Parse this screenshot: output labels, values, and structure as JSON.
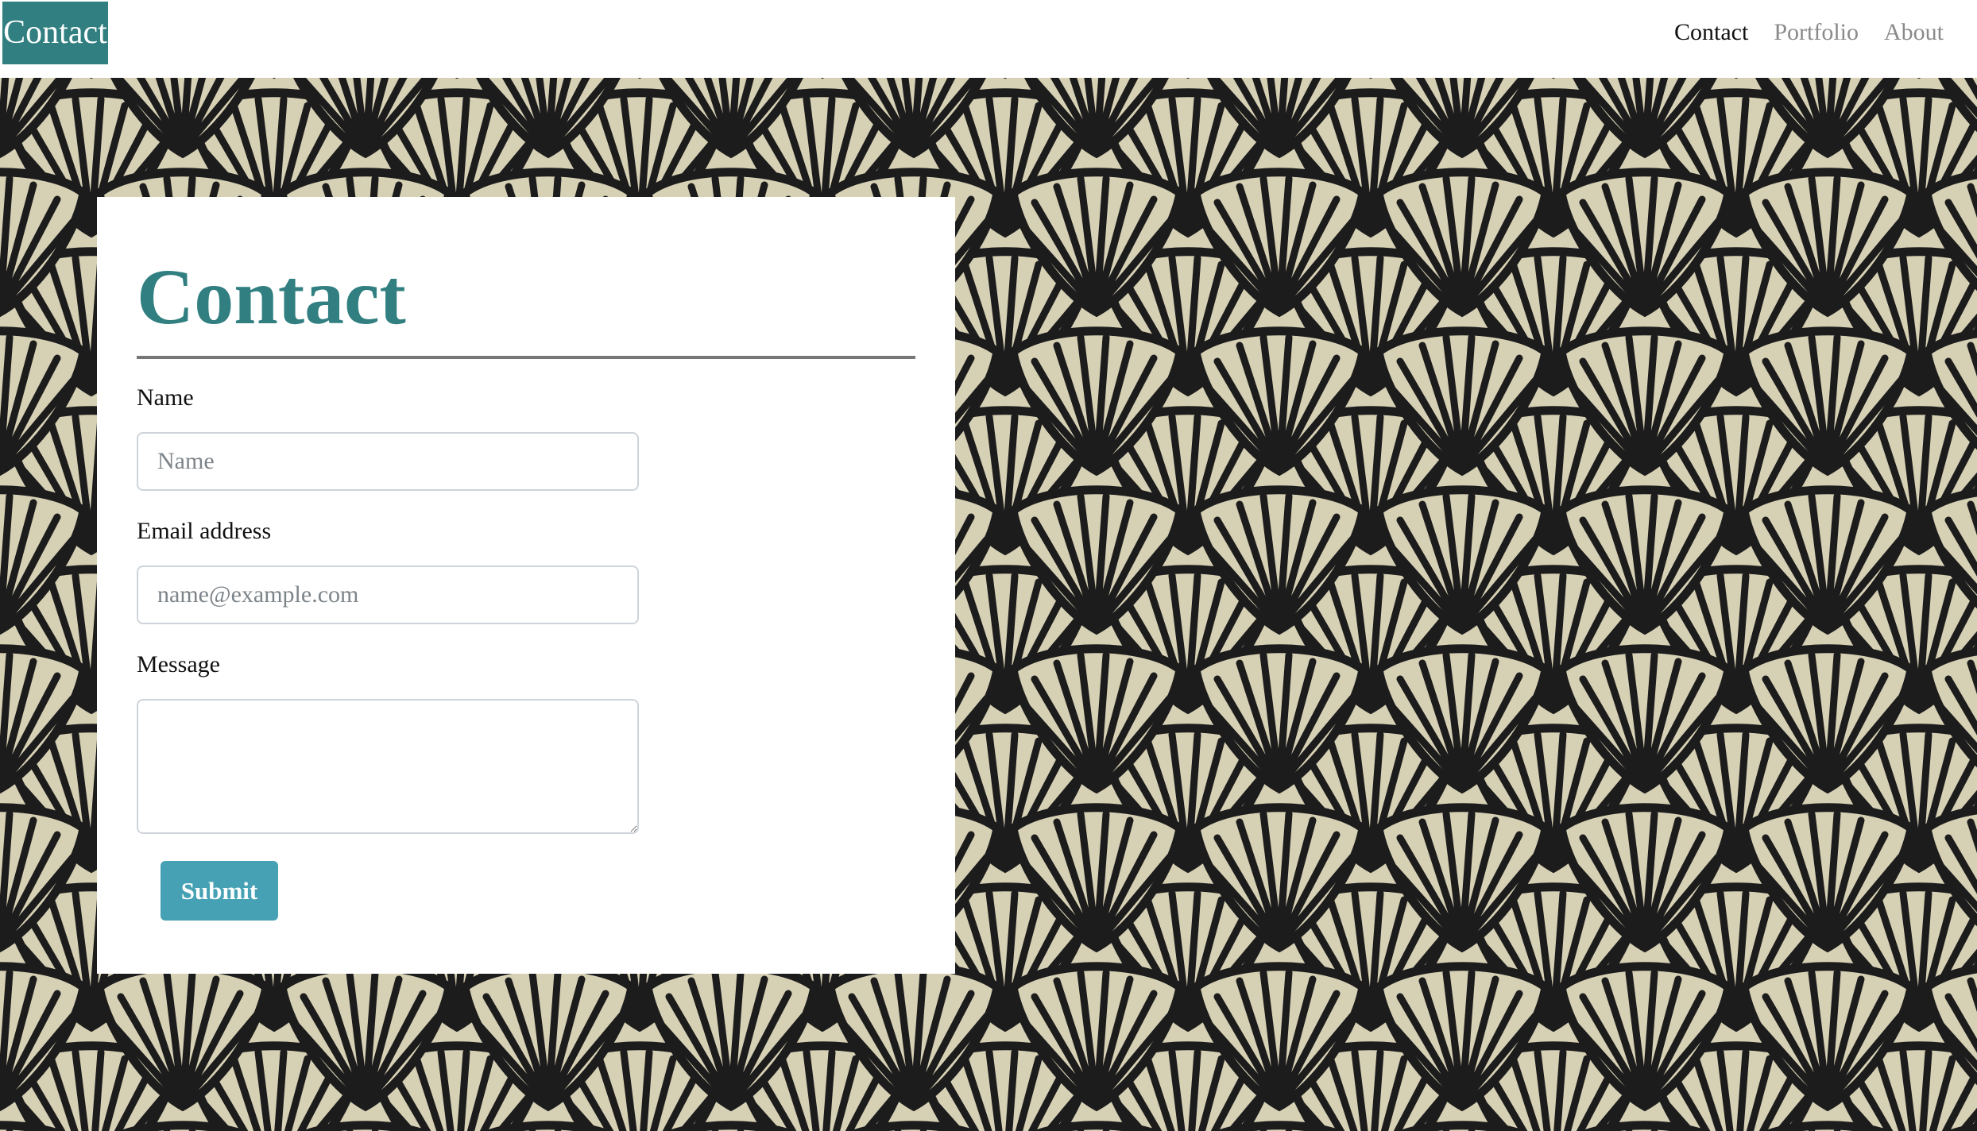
{
  "navbar": {
    "brand": "Contact",
    "links": [
      {
        "label": "Contact",
        "active": true
      },
      {
        "label": "Portfolio",
        "active": false
      },
      {
        "label": "About",
        "active": false
      }
    ]
  },
  "contact_form": {
    "title": "Contact",
    "name_label": "Name",
    "name_placeholder": "Name",
    "name_value": "",
    "email_label": "Email address",
    "email_placeholder": "name@example.com",
    "email_value": "",
    "message_label": "Message",
    "message_value": "",
    "submit_label": "Submit"
  },
  "background": {
    "pattern": "black-line fan / shell floral pattern",
    "base_color": "#d6d0b4",
    "line_color": "#1c1c1c"
  },
  "colors": {
    "accent": "#317f80",
    "button": "#45a1b3",
    "nav_active": "#111111",
    "nav_inactive": "#8a8a8a"
  }
}
